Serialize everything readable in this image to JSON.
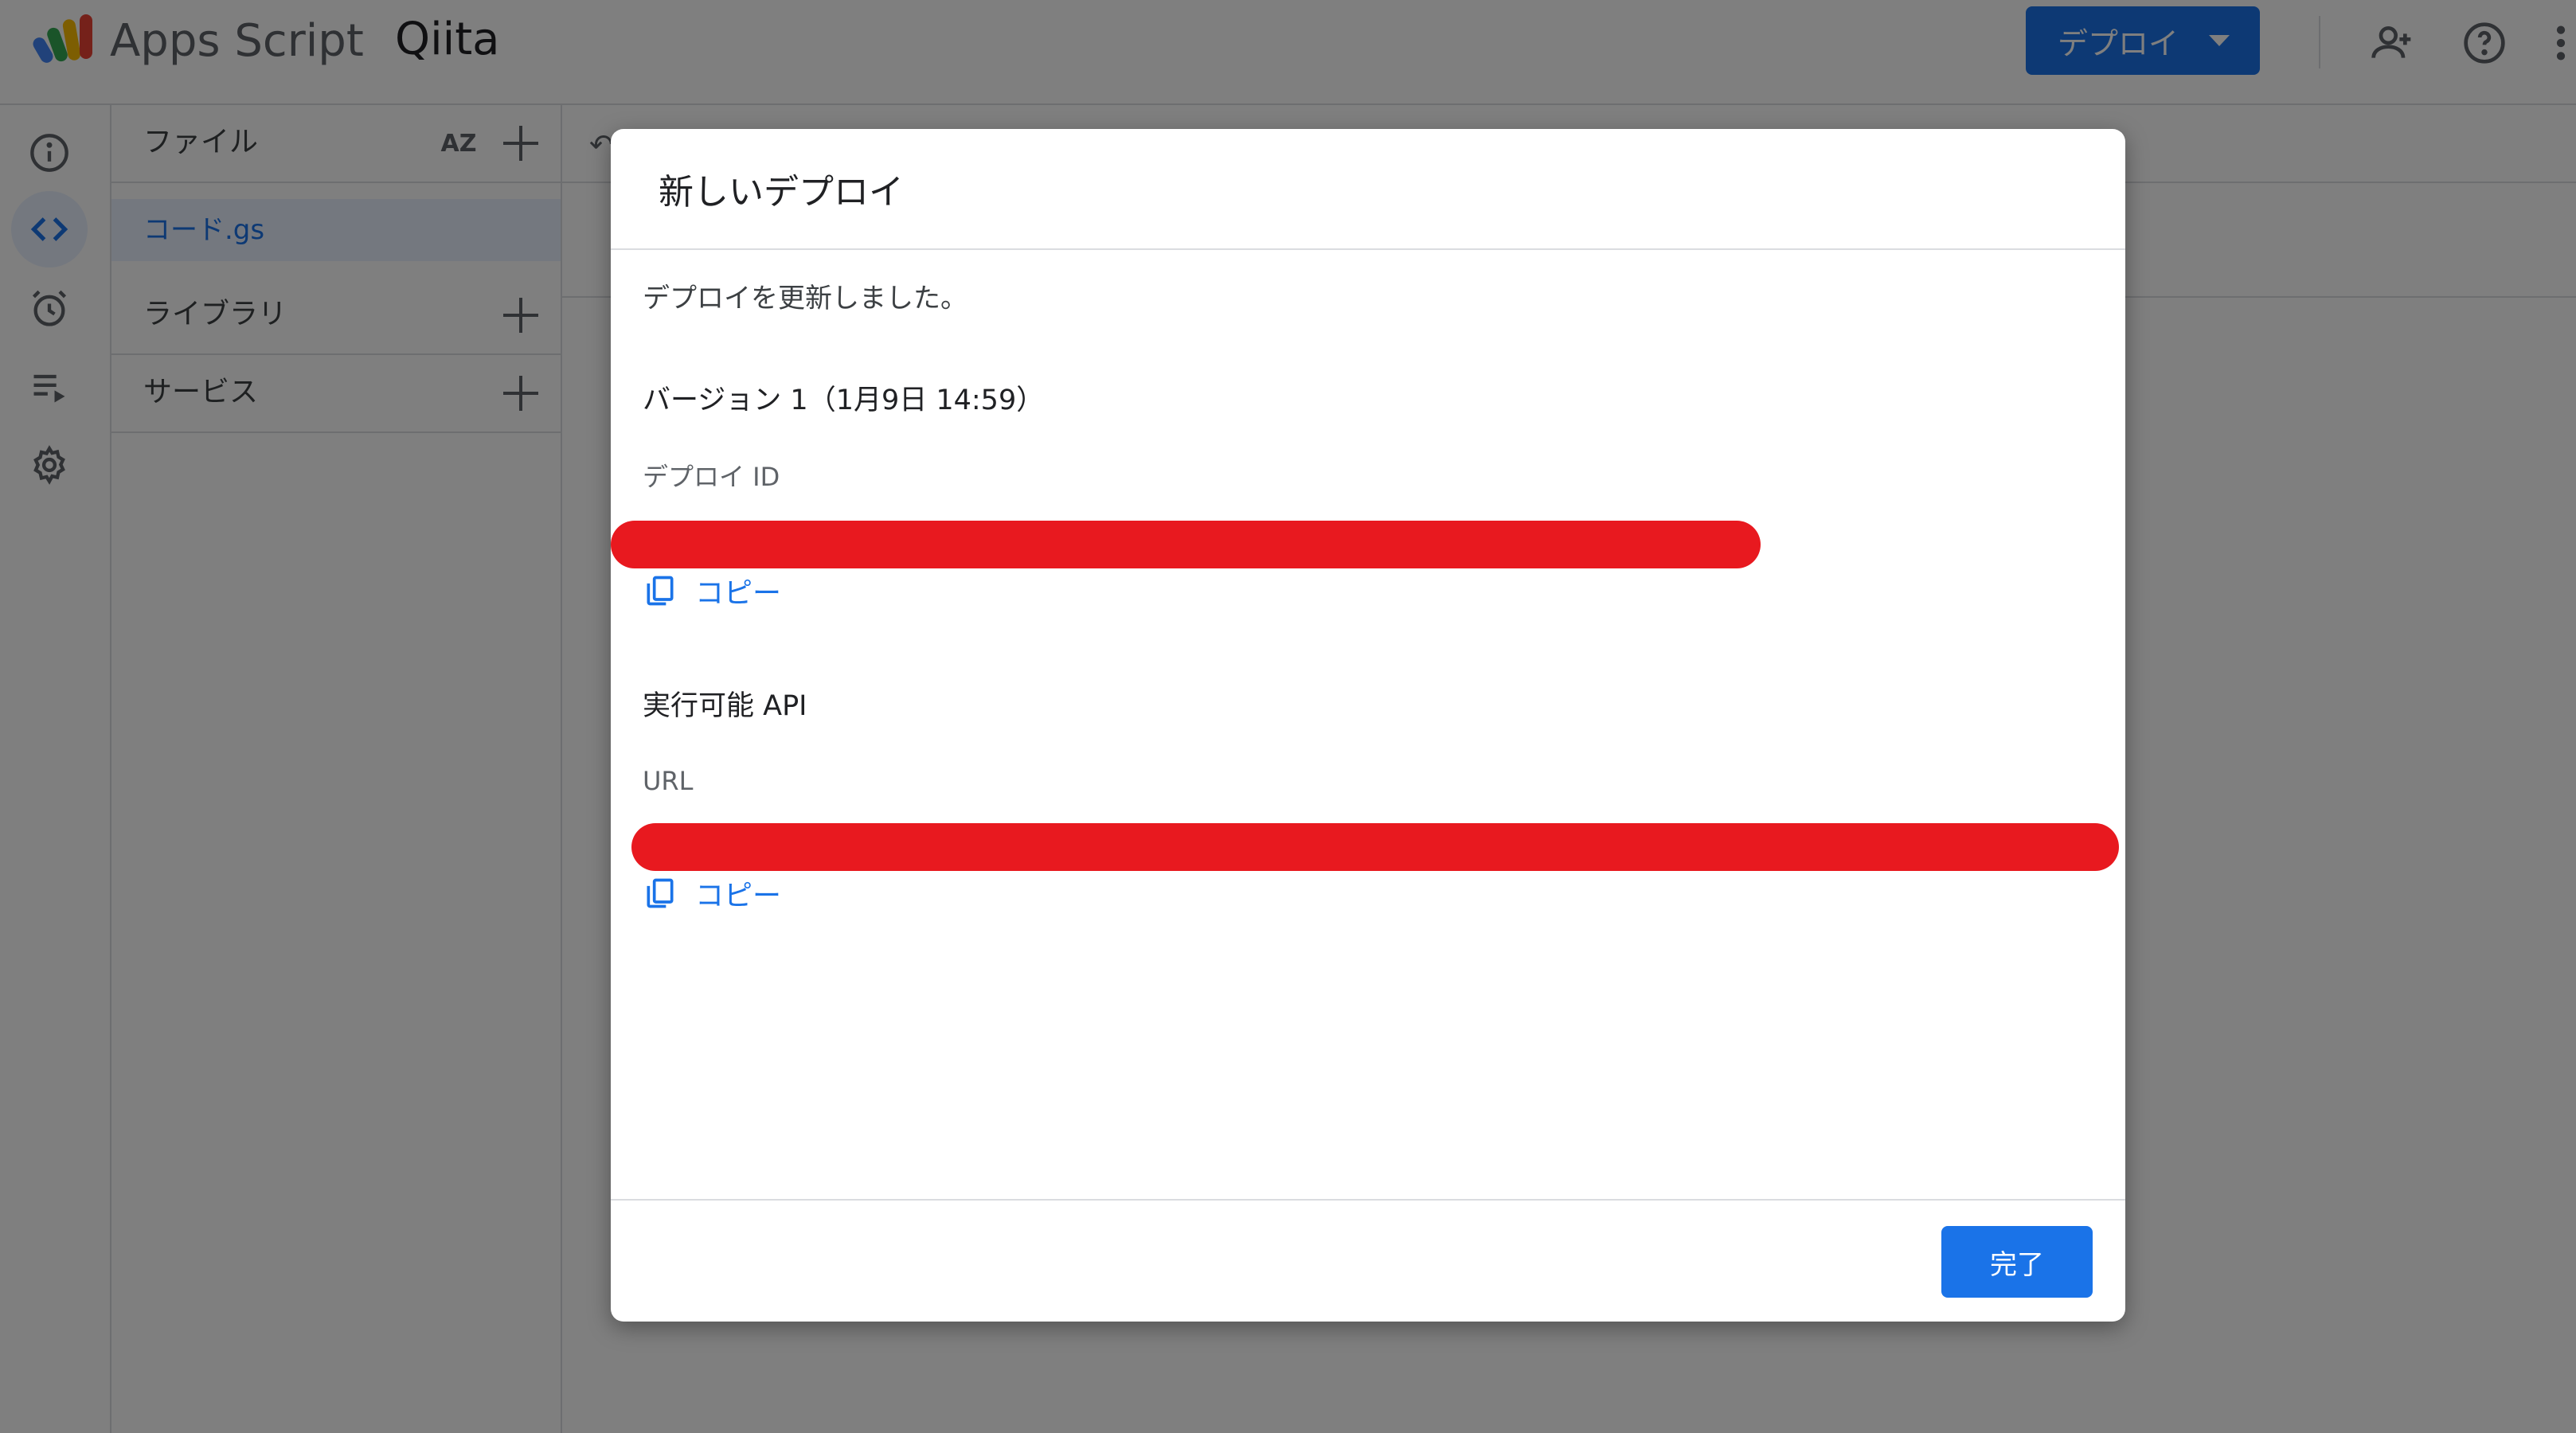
{
  "header": {
    "app_name": "Apps Script",
    "project_name": "Qiita",
    "deploy_button": "デプロイ"
  },
  "sidebar": {
    "rail_icons": [
      "info-icon",
      "code-icon",
      "alarm-icon",
      "executions-icon",
      "settings-icon"
    ],
    "files_section": "ファイル",
    "file_name": "コード.gs",
    "libraries_section": "ライブラリ",
    "services_section": "サービス"
  },
  "dialog": {
    "title": "新しいデプロイ",
    "message": "デプロイを更新しました。",
    "version": "バージョン 1（1月9日 14:59）",
    "deploy_id_label": "デプロイ ID",
    "copy_label": "コピー",
    "section_api": "実行可能 API",
    "url_label": "URL",
    "done_button": "完了"
  },
  "colors": {
    "accent": "#1a73e8",
    "redaction": "#e8191f",
    "overlay": "rgba(0,0,0,0.5)"
  }
}
